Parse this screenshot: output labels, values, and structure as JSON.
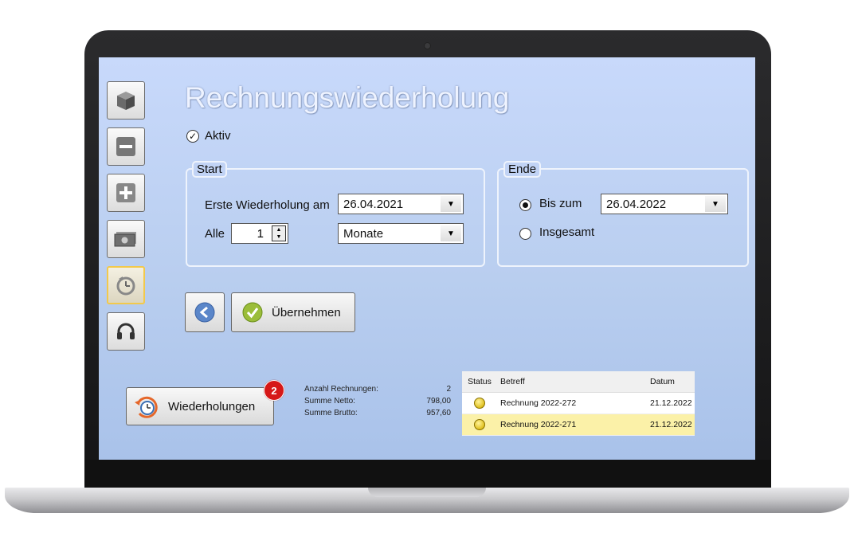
{
  "title": "Rechnungswiederholung",
  "aktiv": {
    "label": "Aktiv",
    "checked": true
  },
  "start": {
    "legend": "Start",
    "first_label": "Erste Wiederholung am",
    "first_date": "26.04.2021",
    "every_label": "Alle",
    "every_value": "1",
    "unit": "Monate"
  },
  "ende": {
    "legend": "Ende",
    "bis_label": "Bis zum",
    "bis_date": "26.04.2022",
    "insgesamt_label": "Insgesamt",
    "selected": "Bis zum"
  },
  "apply_label": "Übernehmen",
  "repeats_button": {
    "label": "Wiederholungen",
    "badge": "2"
  },
  "stats": {
    "labels": [
      "Anzahl Rechnungen:",
      "Summe Netto:",
      "Summe Brutto:"
    ],
    "values": [
      "2",
      "798,00",
      "957,60"
    ]
  },
  "grid": {
    "headers": [
      "Status",
      "Betreff",
      "Datum"
    ],
    "rows": [
      {
        "betreff": "Rechnung 2022-272",
        "datum": "21.12.2022",
        "status": "yellow"
      },
      {
        "betreff": "Rechnung 2022-271",
        "datum": "21.12.2022",
        "status": "yellow"
      }
    ]
  },
  "sidebar_icons": [
    "box-icon",
    "minus-icon",
    "plus-icon",
    "money-icon",
    "repeat-clock-icon",
    "headset-icon"
  ],
  "colors": {
    "screen_bg": "#c8d9fb",
    "selected_row": "#fbf1a8",
    "badge": "#d61818",
    "active_border": "#f2c94c"
  }
}
